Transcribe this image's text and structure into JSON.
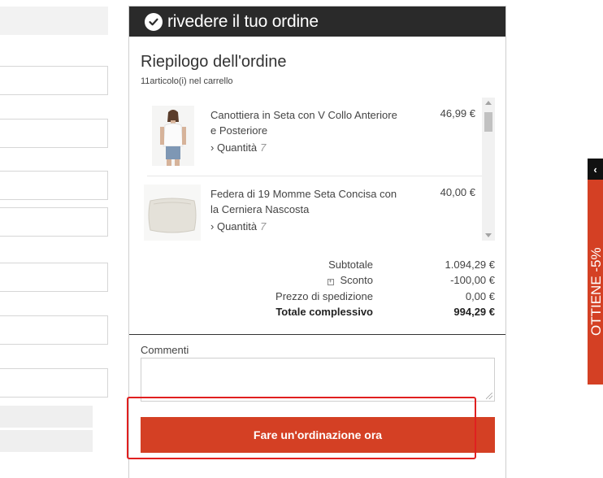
{
  "header": {
    "title": "rivedere il tuo ordine",
    "icon": "check-circle-icon"
  },
  "summary": {
    "title": "Riepilogo dell'ordine",
    "cart_count": "11articolo(i) nel carrello"
  },
  "items": [
    {
      "name": "Canottiera in Seta con V Collo Anteriore e Posteriore",
      "qty_label": "Quantità",
      "qty": "7",
      "price": "46,99 €"
    },
    {
      "name": "Federa di 19 Momme Seta Concisa con la Cerniera Nascosta",
      "qty_label": "Quantità",
      "qty": "7",
      "price": "40,00 €"
    }
  ],
  "totals": {
    "subtotal_label": "Subtotale",
    "subtotal": "1.094,29 €",
    "discount_label": "Sconto",
    "discount": "-100,00 €",
    "shipping_label": "Prezzo di spedizione",
    "shipping": "0,00 €",
    "grand_label": "Totale complessivo",
    "grand": "994,29 €"
  },
  "comments": {
    "label": "Commenti",
    "value": ""
  },
  "order_button": "Fare un'ordinazione ora",
  "promo": {
    "text": "OTTIENE -5%",
    "collapse_glyph": "‹"
  },
  "colors": {
    "accent": "#d44024",
    "header_bg": "#2a2a2a",
    "highlight": "#e02020"
  }
}
